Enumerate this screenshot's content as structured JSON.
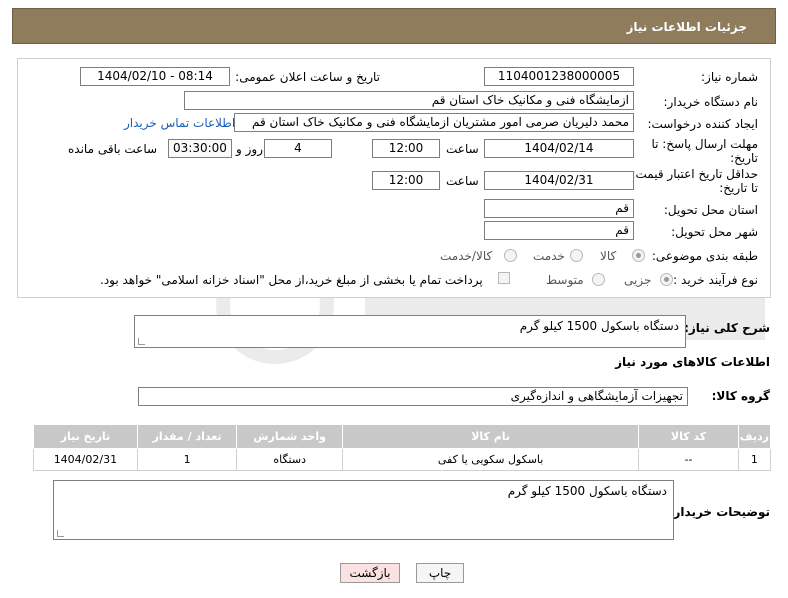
{
  "header": {
    "title": "جزئیات اطلاعات نیاز"
  },
  "fields": {
    "need_number_label": "شماره نیاز:",
    "need_number": "1104001238000005",
    "announce_label": "تاریخ و ساعت اعلان عمومی:",
    "announce_value": "1404/02/10 - 08:14",
    "buyer_org_label": "نام دستگاه خریدار:",
    "buyer_org": "ازمایشگاه فنی و مکانیک خاک استان قم",
    "creator_label": "ایجاد کننده درخواست:",
    "creator": "محمد دلیریان صرمی امور مشتریان ازمایشگاه فنی و مکانیک خاک استان قم",
    "contact_link": "اطلاعات تماس خریدار",
    "deadline_label_1": "مهلت ارسال پاسخ: تا",
    "deadline_label_2": "تاریخ:",
    "deadline_date": "1404/02/14",
    "hour_label": "ساعت",
    "deadline_hour": "12:00",
    "days_value": "4",
    "days_label": "روز و",
    "remaining_time": "03:30:00",
    "remaining_label": "ساعت باقی مانده",
    "min_validity_label_1": "حداقل تاریخ اعتبار قیمت:",
    "min_validity_label_2": "تا تاریخ:",
    "validity_date": "1404/02/31",
    "validity_hour": "12:00",
    "province_label": "استان محل تحویل:",
    "province": "قم",
    "city_label": "شهر محل تحویل:",
    "city": "قم",
    "category_label": "طبقه بندی موضوعی:",
    "category_options": [
      "کالا",
      "خدمت",
      "کالا/خدمت"
    ],
    "process_label": "نوع فرآیند خرید :",
    "process_options": [
      "جزیی",
      "متوسط"
    ],
    "payment_note": "پرداخت تمام یا بخشی از مبلغ خرید،از محل \"اسناد خزانه اسلامی\" خواهد بود."
  },
  "description": {
    "label": "شرح کلی نیاز:",
    "value": "دستگاه باسکول 1500 کیلو گرم"
  },
  "goods_section": {
    "title": "اطلاعات کالاهای مورد نیاز",
    "group_label": "گروه کالا:",
    "group_value": "تجهیزات آزمایشگاهی و اندازه‌گیری"
  },
  "table": {
    "headers": [
      "ردیف",
      "کد کالا",
      "نام کالا",
      "واحد شمارش",
      "تعداد / مقدار",
      "تاریخ نیاز"
    ],
    "rows": [
      [
        "1",
        "--",
        "باسکول سکویی یا کفی",
        "دستگاه",
        "1",
        "1404/02/31"
      ]
    ]
  },
  "buyer_notes": {
    "label": "توضیحات خریدار:",
    "value": "دستگاه باسکول 1500 کیلو گرم"
  },
  "buttons": {
    "print": "چاپ",
    "back": "بازگشت"
  },
  "colors": {
    "header_bg": "#8e7c5c",
    "table_header_bg": "#c8c8c8",
    "back_button_bg": "#fbe1e1",
    "link": "#1a5fb4"
  }
}
